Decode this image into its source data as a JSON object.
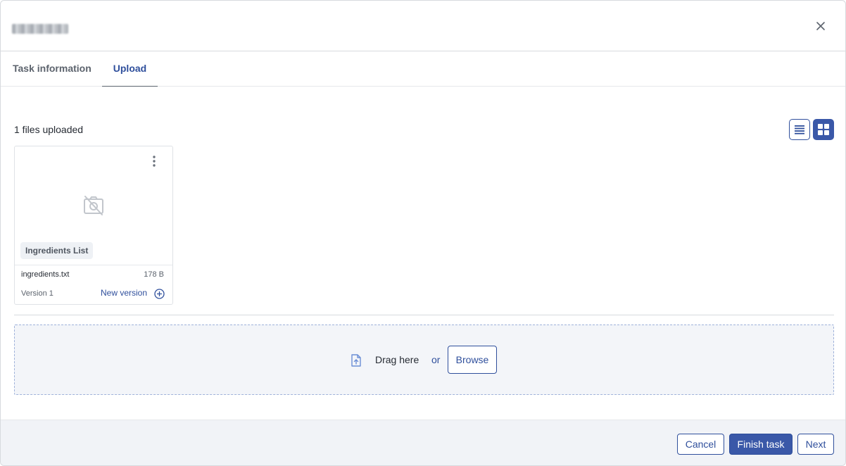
{
  "tabs": [
    {
      "label": "Task information",
      "active": false
    },
    {
      "label": "Upload",
      "active": true
    }
  ],
  "upload": {
    "files_count_label": "1 files uploaded",
    "view_modes": [
      "list",
      "grid"
    ],
    "active_view": "grid",
    "files": [
      {
        "tag": "Ingredients List",
        "name": "ingredients.txt",
        "size": "178 B",
        "version": "Version 1",
        "new_version_label": "New version"
      }
    ],
    "dropzone": {
      "drag_label": "Drag here",
      "or_label": "or",
      "browse_label": "Browse"
    }
  },
  "footer": {
    "cancel_label": "Cancel",
    "finish_label": "Finish task",
    "next_label": "Next"
  },
  "icons": {
    "close": "close-icon",
    "list_view": "list-view-icon",
    "grid_view": "grid-view-icon",
    "card_menu": "more-vertical-icon",
    "no_preview": "no-image-icon",
    "new_version": "plus-circle-icon",
    "file_upload": "file-upload-icon"
  },
  "colors": {
    "accent": "#3a58a8",
    "link": "#2f4f9c",
    "footer_bg": "#f1f3f7",
    "dropzone_bg": "#f3f5f9"
  }
}
